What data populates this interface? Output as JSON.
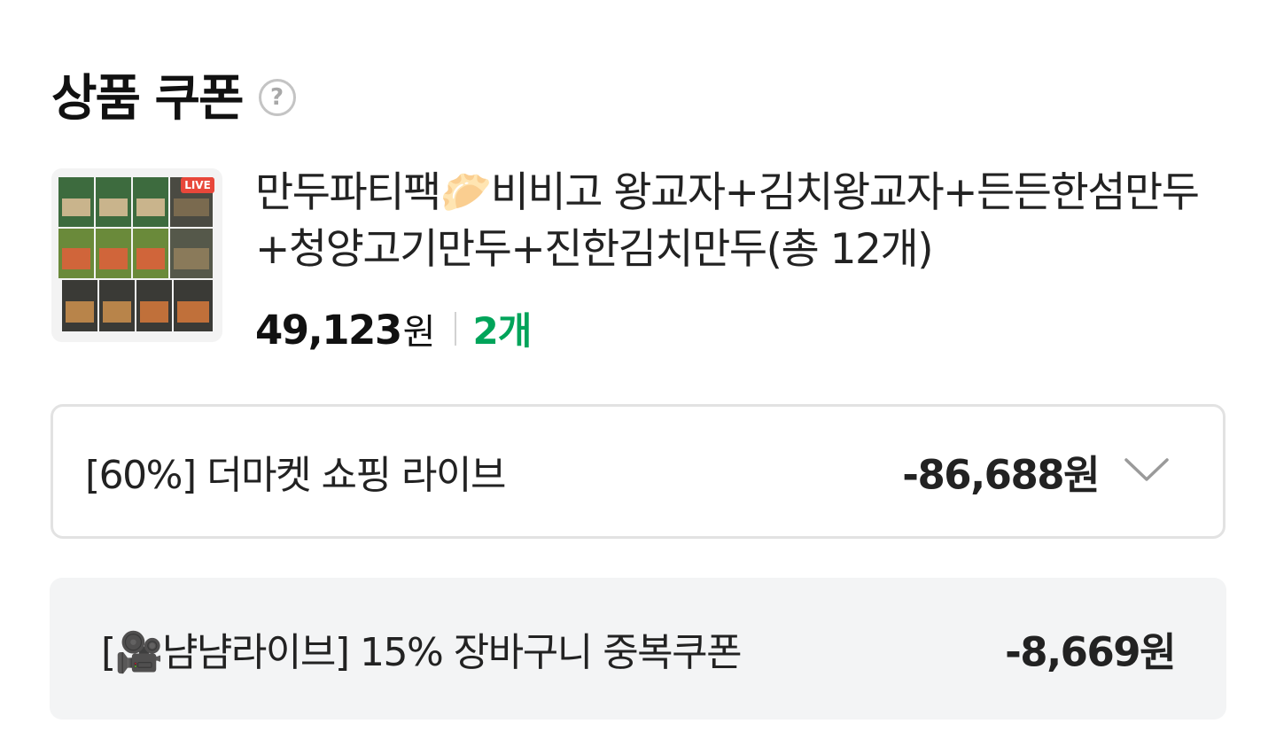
{
  "section": {
    "title": "상품 쿠폰",
    "help_icon": "question-circle-icon"
  },
  "product": {
    "name": "만두파티팩🥟비비고 왕교자+김치왕교자+든든한섬만두+청양고기만두+진한김치만두(총 12개)",
    "price": "49,123",
    "price_unit": "원",
    "quantity": "2개",
    "badge": "LIVE",
    "thumbnail_icon": "product-image"
  },
  "coupons": {
    "selected": {
      "label": "[60%] 더마켓 쇼핑 라이브",
      "amount": "-86,688원",
      "icon": "chevron-down-icon"
    },
    "duplicate": {
      "label": "[🎥냠냠라이브] 15% 장바구니 중복쿠폰",
      "amount": "-8,669원"
    }
  },
  "colors": {
    "accent_green": "#00a45a",
    "border": "#e2e2e2",
    "panel_bg": "#f3f4f5"
  }
}
